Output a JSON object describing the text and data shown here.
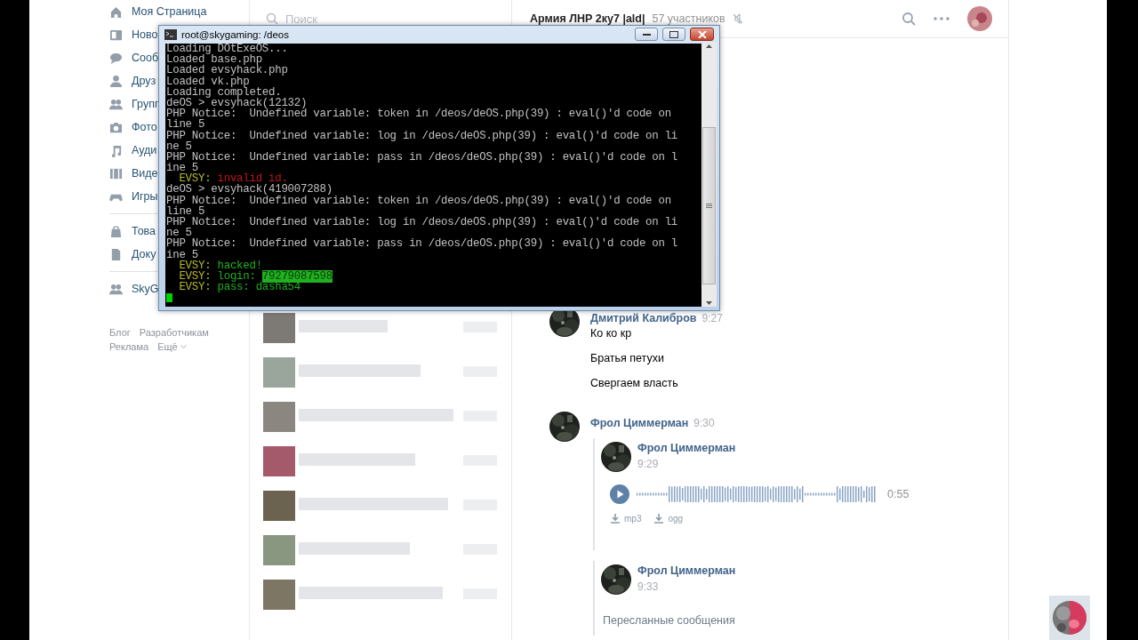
{
  "sidebar": {
    "sections": [
      {
        "items": [
          {
            "label": "Моя Страница"
          },
          {
            "label": "Ново"
          },
          {
            "label": "Сооб"
          },
          {
            "label": "Друз"
          },
          {
            "label": "Групп"
          },
          {
            "label": "Фото"
          },
          {
            "label": "Ауди"
          },
          {
            "label": "Виде"
          },
          {
            "label": "Игры"
          }
        ]
      },
      {
        "items": [
          {
            "label": "Това"
          },
          {
            "label": "Доку"
          }
        ]
      },
      {
        "items": [
          {
            "label": "SkyG"
          }
        ]
      }
    ],
    "footer_links": [
      "Блог",
      "Разработчикам",
      "Реклама",
      "Ещё"
    ]
  },
  "dialogs": {
    "search": {
      "placeholder": "Поиск"
    }
  },
  "chat": {
    "title": "Армия ЛНР 2ку7 |ald|",
    "members": "57 участников",
    "muted": true,
    "messages": [
      {
        "author": "Дмитрий Калибров",
        "time": "9:27",
        "texts": [
          "Ко ко кр",
          "Братья петухи",
          "Свергаем власть"
        ]
      },
      {
        "author": "Фрол Циммерман",
        "time": "9:30",
        "forwarded": [
          {
            "author": "Фрол Циммерман",
            "time": "9:29",
            "attachment": {
              "kind": "audio",
              "duration": "0:55",
              "downloads": [
                "mp3",
                "ogg"
              ]
            }
          },
          {
            "author": "Фрол Циммерман",
            "time": "9:33",
            "link": "Пересланные сообщения"
          }
        ]
      }
    ]
  },
  "terminal": {
    "title": "root@skygaming: /deos",
    "cursor": true,
    "lines": [
      {
        "text": "Loading DOtExeOS..."
      },
      {
        "text": "Loaded base.php"
      },
      {
        "text": "Loaded evsyhack.php"
      },
      {
        "text": "Loaded vk.php"
      },
      {
        "text": "Loading completed."
      },
      {
        "text": "deOS > evsyhack(12132)"
      },
      {
        "text": "PHP Notice:  Undefined variable: token in /deos/deOS.php(39) : eval()'d code on"
      },
      {
        "text": "line 5"
      },
      {
        "text": "PHP Notice:  Undefined variable: log in /deos/deOS.php(39) : eval()'d code on li"
      },
      {
        "text": "ne 5"
      },
      {
        "text": "PHP Notice:  Undefined variable: pass in /deos/deOS.php(39) : eval()'d code on l"
      },
      {
        "text": "ine 5"
      },
      {
        "segments": [
          {
            "text": "  EVSY: ",
            "color": "#b8b82a"
          },
          {
            "text": "invalid id.",
            "color": "#c01818"
          }
        ]
      },
      {
        "text": "deOS > evsyhack(419007288)"
      },
      {
        "text": "PHP Notice:  Undefined variable: token in /deos/deOS.php(39) : eval()'d code on"
      },
      {
        "text": "line 5"
      },
      {
        "text": "PHP Notice:  Undefined variable: log in /deos/deOS.php(39) : eval()'d code on li"
      },
      {
        "text": "ne 5"
      },
      {
        "text": "PHP Notice:  Undefined variable: pass in /deos/deOS.php(39) : eval()'d code on l"
      },
      {
        "text": "ine 5"
      },
      {
        "segments": [
          {
            "text": "  EVSY: ",
            "color": "#b8b82a"
          },
          {
            "text": "hacked!",
            "color": "#20b020"
          }
        ]
      },
      {
        "segments": [
          {
            "text": "  EVSY: ",
            "color": "#b8b82a"
          },
          {
            "text": "login: ",
            "color": "#20b020"
          },
          {
            "text": "79279087598",
            "color": "#20b020",
            "selected": true
          }
        ]
      },
      {
        "segments": [
          {
            "text": "  EVSY: ",
            "color": "#b8b82a"
          },
          {
            "text": "pass: dasha54",
            "color": "#20b020"
          }
        ]
      }
    ]
  }
}
